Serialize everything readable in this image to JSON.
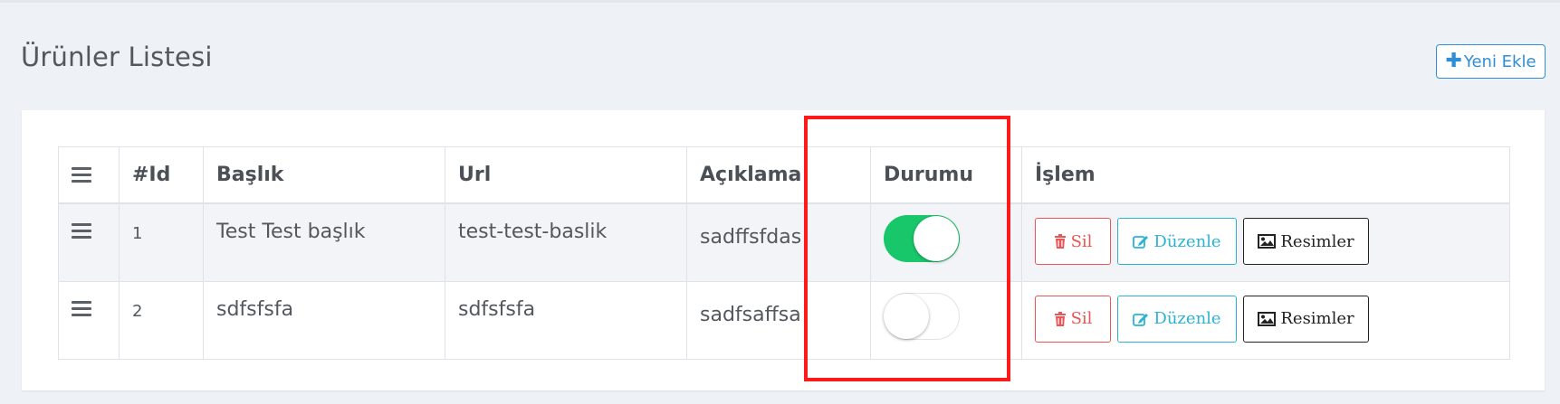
{
  "page": {
    "title": "Ürünler Listesi",
    "add_button_label": "Yeni Ekle",
    "add_button_icon": "plus-icon"
  },
  "table": {
    "columns": [
      "",
      "#Id",
      "Başlık",
      "Url",
      "Açıklama",
      "Durumu",
      "İşlem"
    ],
    "rows": [
      {
        "id": "1",
        "title": "Test Test başlık",
        "url": "test-test-baslik",
        "description": "sadffsfdas",
        "status_on": true
      },
      {
        "id": "2",
        "title": "sdfsfsfa",
        "url": "sdfsfsfa",
        "description": "sadfsaffsa",
        "status_on": false
      }
    ],
    "actions": {
      "delete_label": "Sil",
      "edit_label": "Düzenle",
      "images_label": "Resimler"
    }
  },
  "colors": {
    "toggle_on": "#17c76a",
    "delete": "#ea5555",
    "edit": "#2bb3d6",
    "primary": "#2f8ed6",
    "highlight_box": "#ff1a1a"
  }
}
